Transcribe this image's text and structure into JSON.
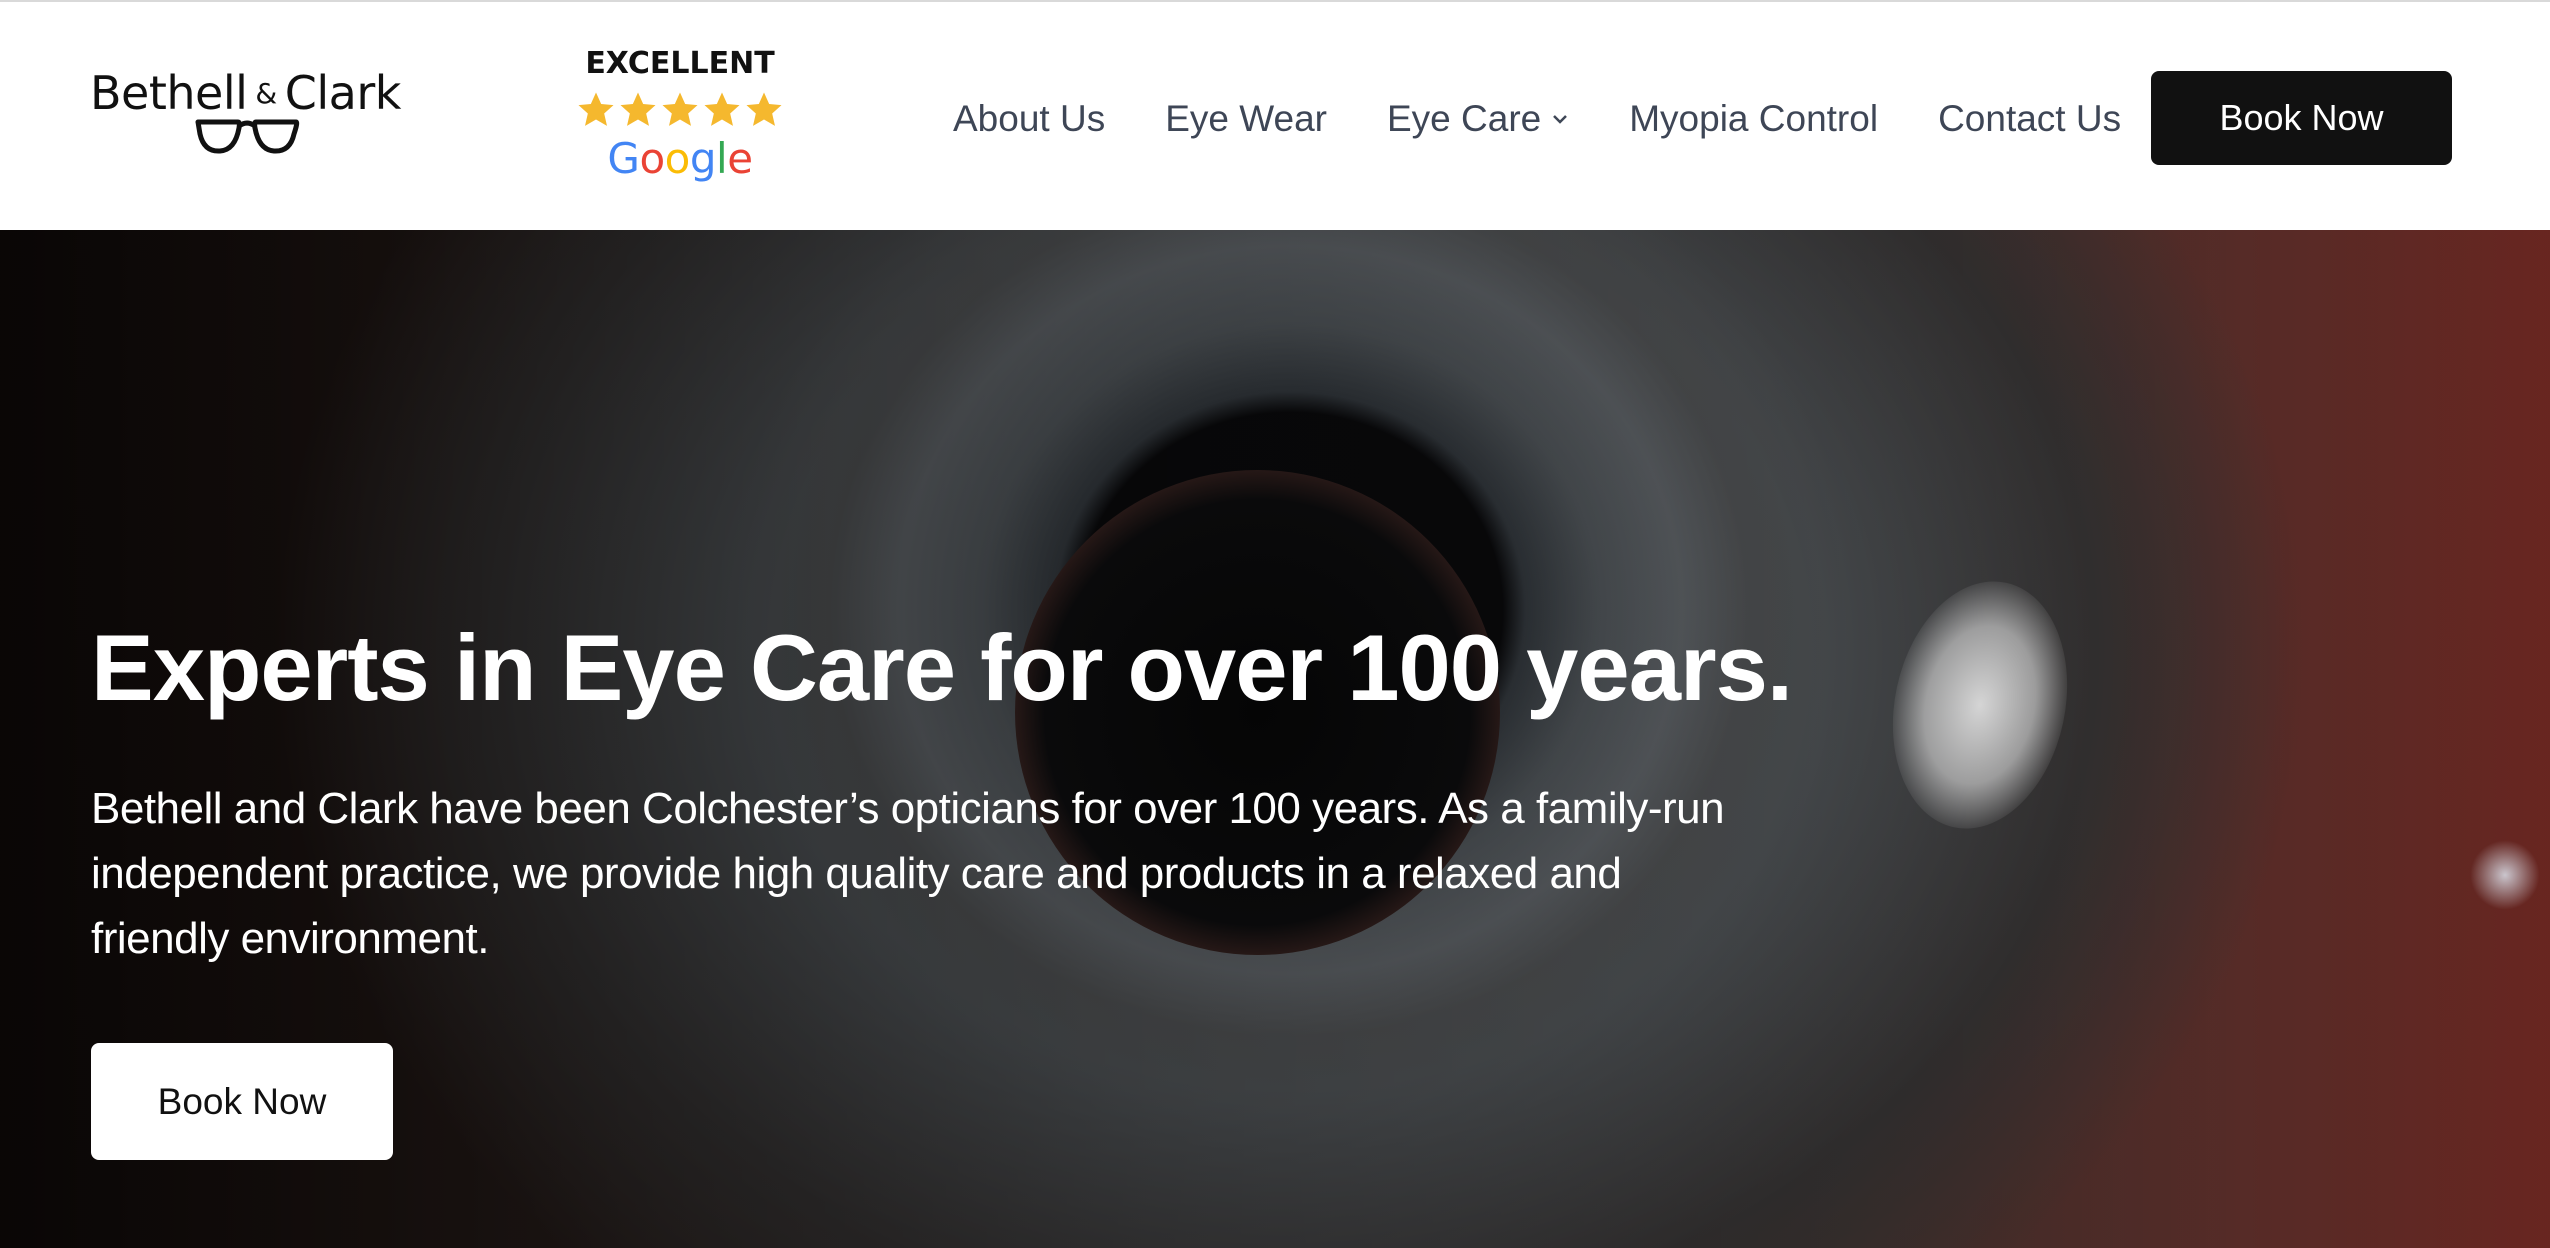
{
  "header": {
    "logo": {
      "name_left": "Bethell",
      "ampersand": "&",
      "name_right": "Clark"
    },
    "rating": {
      "label": "EXCELLENT",
      "stars": 5,
      "provider": "Google",
      "star_color": "#F5B82E"
    },
    "nav": {
      "items": [
        {
          "label": "About Us"
        },
        {
          "label": "Eye Wear"
        },
        {
          "label": "Eye Care"
        },
        {
          "label": "Myopia Control"
        },
        {
          "label": "Contact Us"
        }
      ]
    },
    "cta_label": "Book Now"
  },
  "hero": {
    "title": "Experts in Eye Care for over 100 years.",
    "text": "Bethell and Clark have been Colchester’s opticians for over 100 years. As a family-run independent practice, we provide high quality care and products in a relaxed and friendly environment.",
    "cta_label": "Book Now"
  },
  "colors": {
    "nav_text": "#3E4656",
    "button_dark": "#111111",
    "button_light": "#FFFFFF",
    "google_blue": "#4285F4",
    "google_red": "#EA4335",
    "google_yellow": "#FBBC05",
    "google_green": "#34A853"
  }
}
